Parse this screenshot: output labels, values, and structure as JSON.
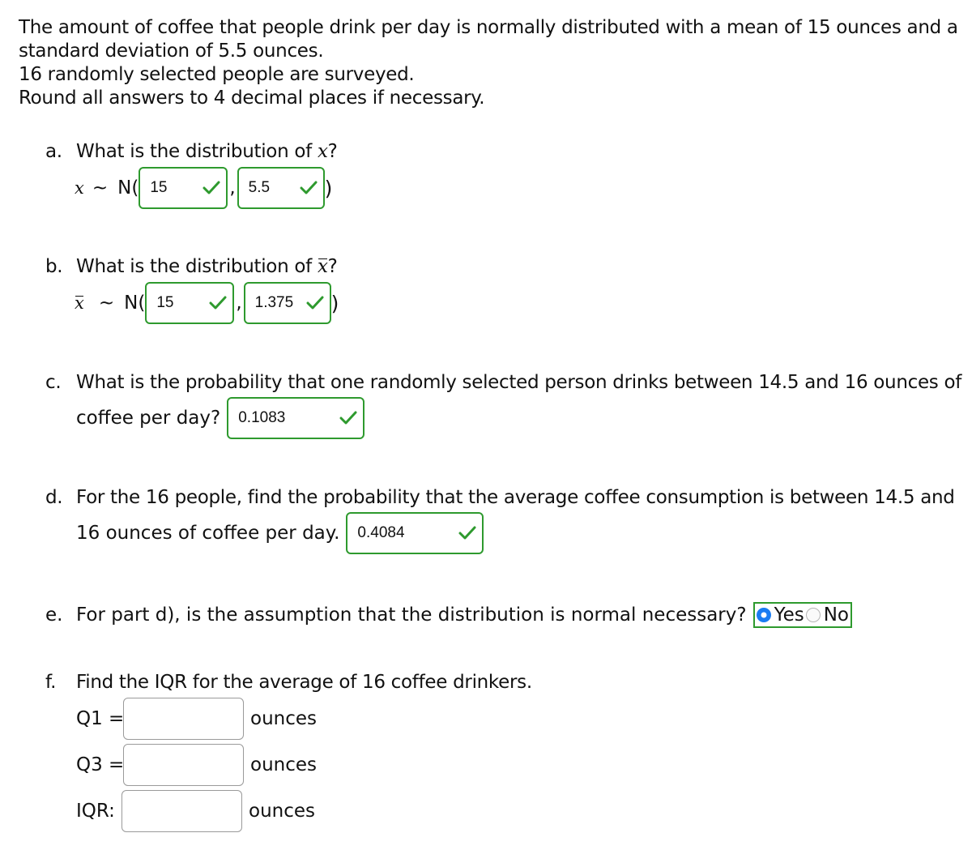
{
  "intro": {
    "line1": "The amount of coffee that people drink per day is normally distributed with a mean of 15 ounces and a",
    "line2": "standard deviation of 5.5 ounces.",
    "line3": "16 randomly selected people are surveyed.",
    "line4": "Round all answers to 4 decimal places if necessary."
  },
  "colors": {
    "correct_border": "#2e9a2e",
    "radio_selected": "#1a7cf2"
  },
  "part_a": {
    "letter": "a.",
    "question": "What is the distribution of ",
    "var": "x",
    "qmark": "?",
    "lhs": "x",
    "tilde": "∼",
    "dist_open": "N(",
    "comma": ",",
    "close": ")",
    "mean": "15",
    "sd": "5.5",
    "status_icon": "check-icon"
  },
  "part_b": {
    "letter": "b.",
    "question": "What is the distribution of ",
    "var": "x",
    "qmark": "?",
    "lhs": "x",
    "tilde": "∼",
    "dist_open": "N(",
    "comma": ",",
    "close": ")",
    "mean": "15",
    "sd": "1.375"
  },
  "part_c": {
    "letter": "c.",
    "line1": "What is the probability that one randomly selected person drinks between 14.5 and 16 ounces of",
    "line2": "coffee per day?",
    "answer": "0.1083"
  },
  "part_d": {
    "letter": "d.",
    "line1": "For the 16 people, find the probability that the average coffee consumption is between 14.5 and",
    "line2": "16 ounces of coffee per day.",
    "answer": "0.4084"
  },
  "part_e": {
    "letter": "e.",
    "question": "For part d), is the assumption that the distribution is normal necessary?",
    "options": [
      {
        "label": "Yes",
        "selected": true
      },
      {
        "label": "No",
        "selected": false
      }
    ]
  },
  "part_f": {
    "letter": "f.",
    "question": "Find the IQR for the average of 16 coffee drinkers.",
    "q1_label": "Q1 =",
    "q3_label": "Q3 =",
    "iqr_label": "IQR:",
    "unit": "ounces",
    "q1_value": "",
    "q3_value": "",
    "iqr_value": ""
  }
}
